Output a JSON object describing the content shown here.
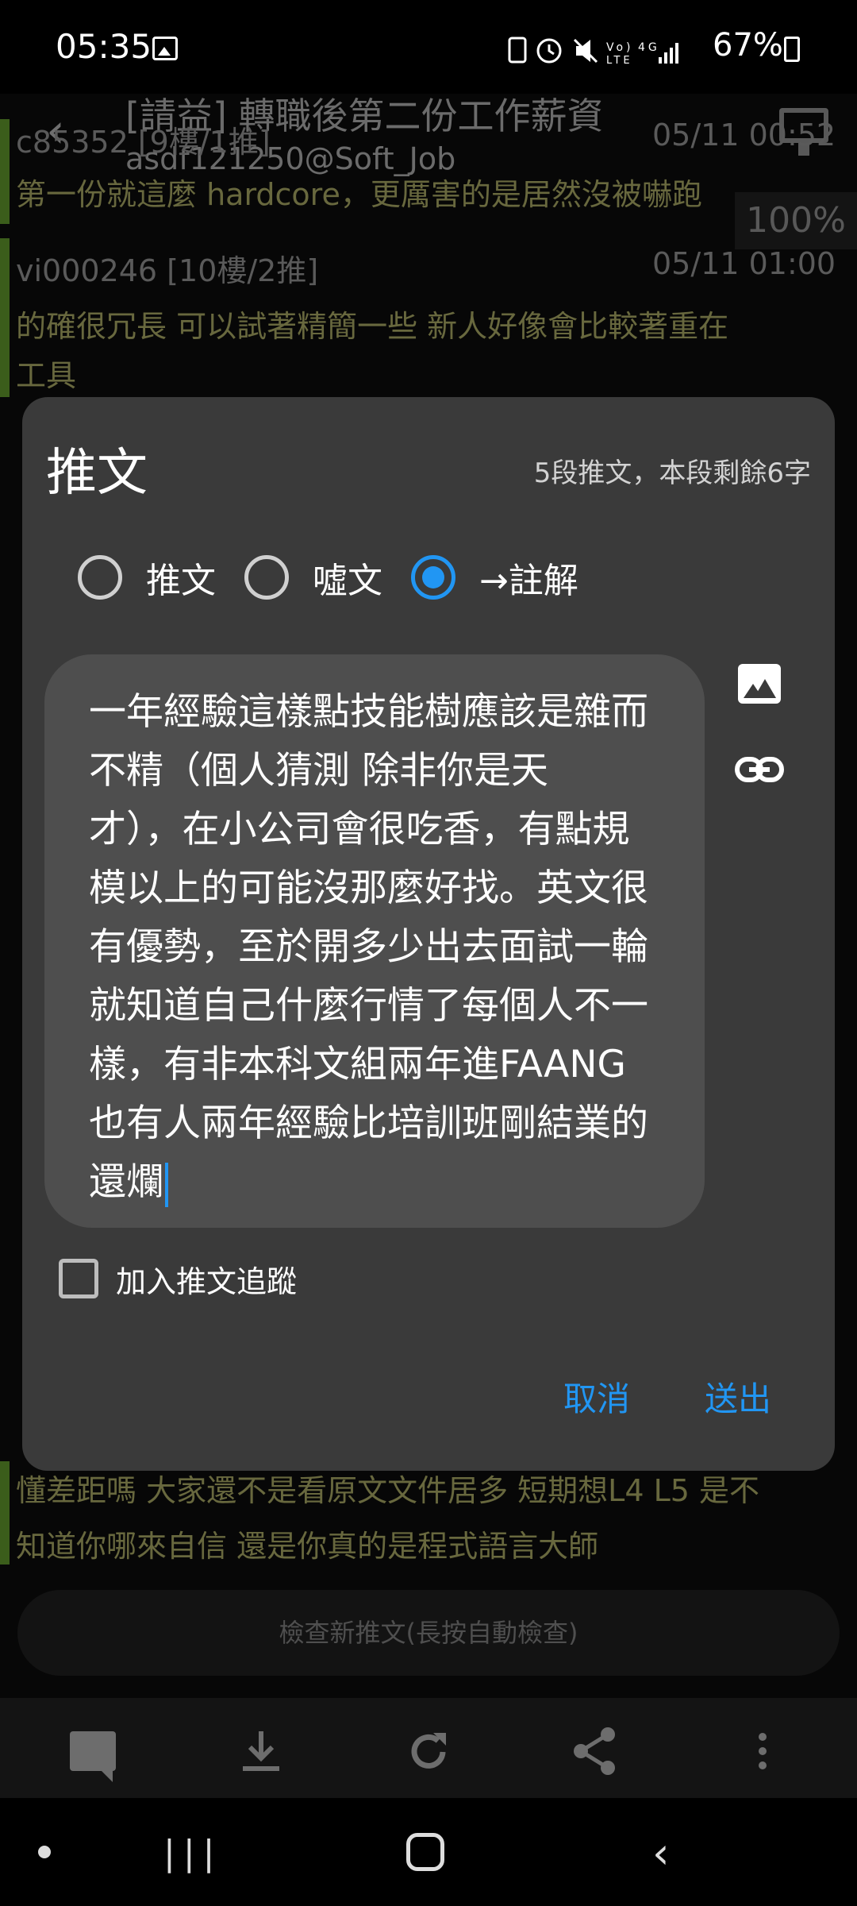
{
  "status_bar": {
    "time": "05:35",
    "icons": "▣ ⏰ 🔇 Vo) 4G ▮",
    "battery": "67%"
  },
  "header": {
    "title": "[請益] 轉職後第二份工作薪資",
    "subtitle": "asdf121250@Soft_Job",
    "zoom": "100%"
  },
  "comments": [
    {
      "author": "c85352 [9樓/1推]",
      "date": "05/11 00:52",
      "text": "第一份就這麼 hardcore，更厲害的是居然沒被嚇跑"
    },
    {
      "author": "vi000246 [10樓/2推]",
      "date": "05/11 01:00",
      "text1": "的確很冗長 可以試著精簡一些 新人好像會比較著重在",
      "text2": "工具"
    },
    {
      "text1": "懂差距嗎 大家還不是看原文文件居多 短期想L4 L5 是不",
      "text2": "知道你哪來自信 還是你真的是程式語言大師"
    }
  ],
  "check_button": "檢查新推文(長按自動檢查)",
  "dialog": {
    "title": "推文",
    "info": "5段推文，本段剩餘6字",
    "options": [
      "推文",
      "噓文",
      "→註解"
    ],
    "selected_option": "→註解",
    "text_value": "一年經驗這樣點技能樹應該是雜而不精（個人猜測 除非你是天才），在小公司會很吃香，有點規模以上的可能沒那麼好找。英文很有優勢，至於開多少出去面試一輪就知道自己什麼行情了每個人不一樣，有非本科文組兩年進FAANG也有人兩年經驗比培訓班剛結業的還爛",
    "text_lines": [
      "一年經驗這樣點技能樹應該是雜而",
      "不精（個人猜測 除非你是天",
      "才），在小公司會很吃香，有點規",
      "模以上的可能沒那麼好找。英文很",
      "有優勢，至於開多少出去面試一輪",
      "就知道自己什麼行情了每個人不一",
      "樣，有非本科文組兩年進FAANG",
      "也有人兩年經驗比培訓班剛結業的",
      "還爛"
    ],
    "follow_label": "加入推文追蹤",
    "follow_checked": false,
    "cancel_label": "取消",
    "send_label": "送出"
  },
  "colors": {
    "accent": "#2196f3",
    "dialog_bg": "#3a3a3a",
    "textarea_bg": "#4e4e4e",
    "comment_text": "#a0a060"
  },
  "toolbar_icons": [
    "comment-icon",
    "download-icon",
    "refresh-icon",
    "share-icon",
    "more-vert-icon"
  ],
  "nav_icons": [
    "dot-icon",
    "recent-apps-icon",
    "home-icon",
    "back-icon"
  ]
}
